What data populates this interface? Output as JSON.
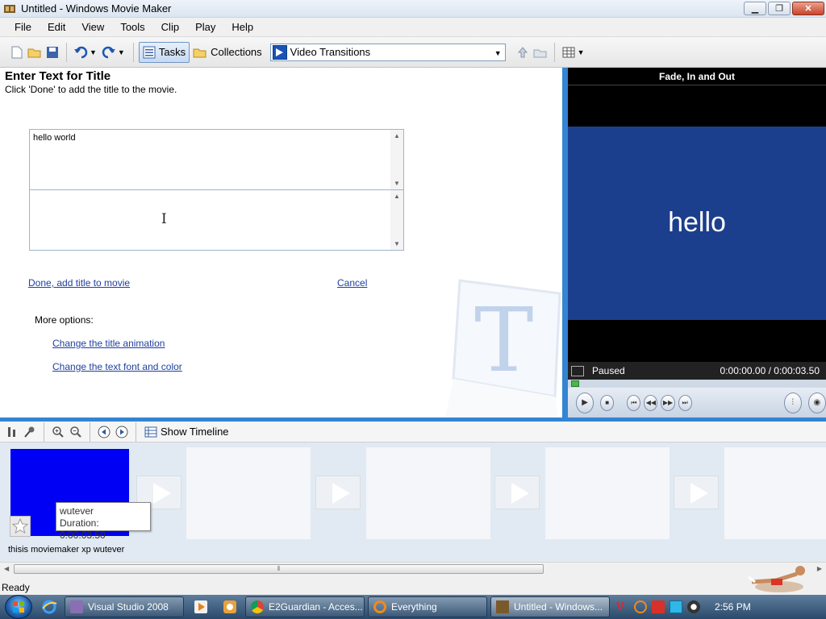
{
  "window": {
    "title": "Untitled - Windows Movie Maker",
    "min_glyph": "▁",
    "max_glyph": "❐",
    "close_glyph": "✕"
  },
  "menu": [
    {
      "label": "File"
    },
    {
      "label": "Edit"
    },
    {
      "label": "View"
    },
    {
      "label": "Tools"
    },
    {
      "label": "Clip"
    },
    {
      "label": "Play"
    },
    {
      "label": "Help"
    }
  ],
  "toolbar": {
    "tasks_label": "Tasks",
    "collections_label": "Collections",
    "collection_selected": "Video Transitions"
  },
  "task_pane": {
    "heading": "Enter Text for Title",
    "subtext": "Click 'Done' to add the title to the movie.",
    "title_text": "hello world",
    "subtitle_text": "",
    "done_link": "Done, add title to movie",
    "cancel_link": "Cancel",
    "more_options": "More options:",
    "option_animation": "Change the title animation",
    "option_font": "Change the text font and color"
  },
  "monitor": {
    "title": "Fade, In and Out",
    "preview_text": "hello",
    "status": "Paused",
    "time": "0:00:00.00 / 0:00:03.50",
    "seek_progress": 0.0
  },
  "storyboard_toolbar": {
    "show_timeline": "Show Timeline"
  },
  "storyboard": {
    "tooltip_name": "wutever",
    "tooltip_duration": "Duration:  0:00:03.50",
    "clip_caption": "thisis moviemaker xp wutever"
  },
  "statusbar": {
    "text": "Ready"
  },
  "taskbar": {
    "items": [
      {
        "label": "Visual Studio 2008"
      },
      {
        "label": "E2Guardian - Acces..."
      },
      {
        "label": "Everything"
      },
      {
        "label": "Untitled - Windows..."
      }
    ],
    "clock": "2:56 PM"
  },
  "colors": {
    "accent_blue": "#3484d4",
    "clip_blue": "#0000f5",
    "preview_bg": "#1b3f8c"
  },
  "icons": [
    "movie-maker-icon",
    "new-icon",
    "open-icon",
    "save-icon",
    "undo-icon",
    "redo-icon",
    "tasks-icon",
    "collections-folder-icon",
    "transition-icon",
    "up-folder-icon",
    "new-folder-icon",
    "view-icon",
    "windows-orb-icon",
    "ie-icon"
  ]
}
